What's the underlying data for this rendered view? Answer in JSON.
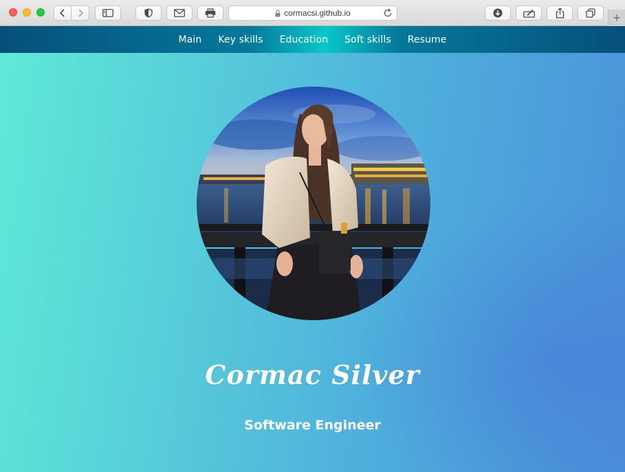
{
  "browser": {
    "url": "cormacsi.github.io",
    "new_tab_symbol": "+"
  },
  "nav": {
    "items": [
      {
        "label": "Main"
      },
      {
        "label": "Key skills"
      },
      {
        "label": "Education"
      },
      {
        "label": "Soft skills"
      },
      {
        "label": "Resume"
      }
    ]
  },
  "hero": {
    "name": "Cormac Silver",
    "role": "Software Engineer"
  },
  "icons": {
    "back": "chevron-left-icon",
    "forward": "chevron-right-icon",
    "sidebar": "sidebar-icon",
    "shield": "shield-icon",
    "mail": "mail-icon",
    "print": "printer-icon",
    "lock": "lock-icon",
    "reload": "reload-icon",
    "download": "download-icon",
    "markup": "markup-icon",
    "share": "share-icon",
    "tabs": "tab-overview-icon"
  },
  "colors": {
    "gradient_start": "#5eead7",
    "gradient_end": "#4a90d9",
    "navbar": "#06507a",
    "text": "#ffffff"
  }
}
